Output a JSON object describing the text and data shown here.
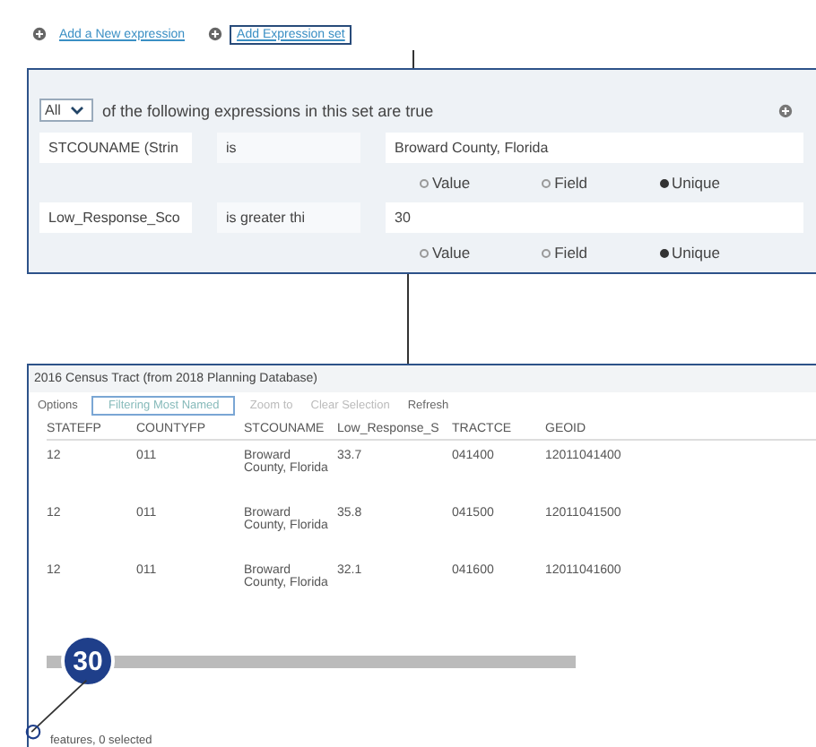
{
  "links": [
    "Add a New expression",
    "Add Expression set"
  ],
  "expression_set": {
    "mode": "All",
    "caption": "of the following expressions in this set are true",
    "expressions": [
      {
        "field": "STCOUNAME (Strin",
        "operator": "is",
        "value": "Broward County, Florida",
        "options": [
          {
            "label": "Value",
            "selected": false
          },
          {
            "label": "Field",
            "selected": false
          },
          {
            "label": "Unique",
            "selected": true
          }
        ]
      },
      {
        "field": "Low_Response_Sco",
        "operator": "is greater thi",
        "value": "30",
        "options": [
          {
            "label": "Value",
            "selected": false
          },
          {
            "label": "Field",
            "selected": false
          },
          {
            "label": "Unique",
            "selected": true
          }
        ]
      }
    ]
  },
  "table": {
    "title": "2016 Census Tract (from 2018 Planning Database)",
    "toolbar": [
      "Options",
      "Filtering Most Named",
      "Zoom to",
      "Clear Selection",
      "Refresh"
    ],
    "columns": [
      "STATEFP",
      "COUNTYFP",
      "STCOUNAME",
      "Low_Response_S",
      "TRACTCE",
      "GEOID"
    ],
    "rows": [
      [
        "12",
        "011",
        "Broward County, Florida",
        "33.7",
        "041400",
        "12011041400"
      ],
      [
        "12",
        "011",
        "Broward County, Florida",
        "35.8",
        "041500",
        "12011041500"
      ],
      [
        "12",
        "011",
        "Broward County, Florida",
        "32.1",
        "041600",
        "12011041600"
      ]
    ]
  },
  "status_bar": "features, 0 selected",
  "callout": "30"
}
